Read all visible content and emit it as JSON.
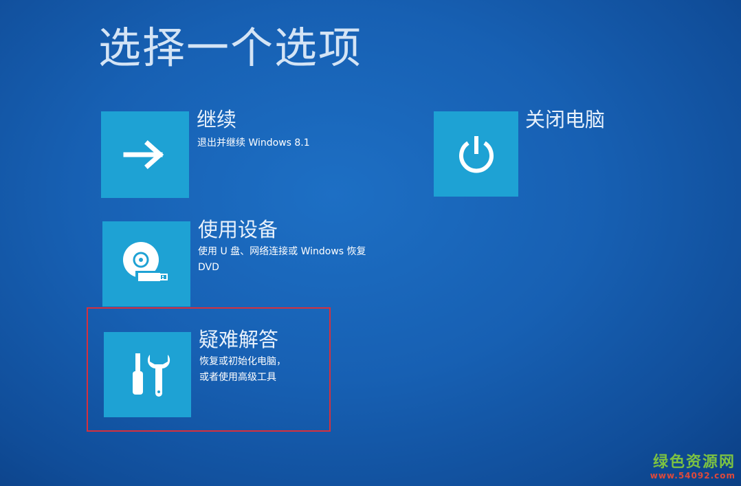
{
  "page": {
    "title": "选择一个选项"
  },
  "options": {
    "continue": {
      "icon": "arrow-right-icon",
      "title": "继续",
      "description": "退出并继续 Windows 8.1"
    },
    "use_device": {
      "icon": "disc-usb-icon",
      "title": "使用设备",
      "description_line1": "使用 U 盘、网络连接或 Windows 恢复",
      "description_line2": "DVD"
    },
    "troubleshoot": {
      "icon": "tools-icon",
      "title": "疑难解答",
      "description_line1": "恢复或初始化电脑，",
      "description_line2": "或者使用高级工具"
    },
    "shutdown": {
      "icon": "power-icon",
      "title": "关闭电脑"
    }
  },
  "watermark": {
    "name": "绿色资源网",
    "url": "www.54092.com"
  },
  "colors": {
    "background": "#1760b3",
    "tile": "#1ea2d4",
    "highlight_box": "#d8303c"
  }
}
